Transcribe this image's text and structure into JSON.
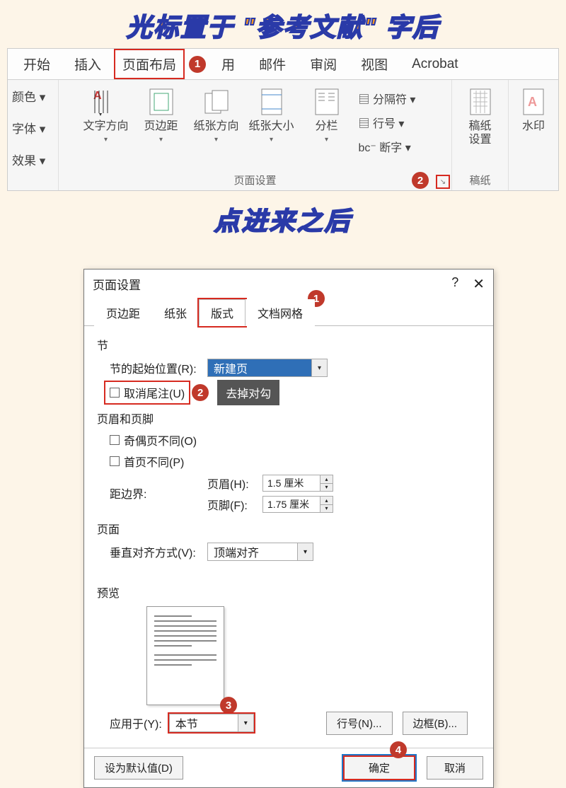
{
  "annotation": {
    "top": "光标置于 \"参考文献\" 字后",
    "mid": "点进来之后"
  },
  "ribbon": {
    "tabs": {
      "start": "开始",
      "insert": "插入",
      "page_layout": "页面布局",
      "ref": "用",
      "mail": "邮件",
      "review": "审阅",
      "view": "视图",
      "acrobat": "Acrobat"
    },
    "side": {
      "color": "颜色 ▾",
      "font": "字体 ▾",
      "effect": "效果 ▾"
    },
    "buttons": {
      "text_dir": "文字方向",
      "margin": "页边距",
      "orient": "纸张方向",
      "size": "纸张大小",
      "columns": "分栏",
      "break": "分隔符 ▾",
      "line_num": "行号 ▾",
      "hyphen": "断字 ▾",
      "manuscript": "稿纸",
      "manuscript_set": "设置",
      "watermark": "水印"
    },
    "group_page_setup": "页面设置",
    "group_manuscript": "稿纸"
  },
  "dialog": {
    "title": "页面设置",
    "tabs": {
      "margin": "页边距",
      "paper": "纸张",
      "layout": "版式",
      "grid": "文档网格"
    },
    "section_label": "节",
    "section_start_label": "节的起始位置(R):",
    "section_start_value": "新建页",
    "suppress_endnote": "取消尾注(U)",
    "tooltip": "去掉对勾",
    "header_footer_label": "页眉和页脚",
    "odd_even": "奇偶页不同(O)",
    "first_page": "首页不同(P)",
    "from_edge": "距边界:",
    "header_label": "页眉(H):",
    "header_value": "1.5 厘米",
    "footer_label": "页脚(F):",
    "footer_value": "1.75 厘米",
    "page_label": "页面",
    "valign_label": "垂直对齐方式(V):",
    "valign_value": "顶端对齐",
    "preview_label": "预览",
    "apply_label": "应用于(Y):",
    "apply_value": "本节",
    "line_num_btn": "行号(N)...",
    "border_btn": "边框(B)...",
    "default_btn": "设为默认值(D)",
    "ok_btn": "确定",
    "cancel_btn": "取消"
  },
  "badges": {
    "one": "1",
    "two": "2",
    "three": "3",
    "four": "4"
  }
}
